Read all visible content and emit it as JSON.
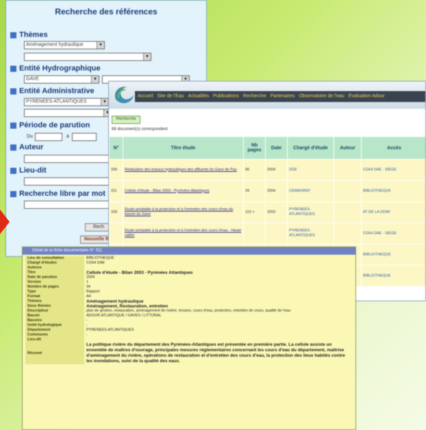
{
  "search_panel": {
    "title": "Recherche des références",
    "sections": {
      "themes": {
        "label": "Thèmes",
        "select1": "Aménagement hydraulique",
        "select2": ""
      },
      "entite_hydro": {
        "label": "Entité Hydrographique",
        "select1": "GAVE",
        "select2": ""
      },
      "entite_admin": {
        "label": "Entité Administrative",
        "select1": "PYRENEES-ATLANTIQUES",
        "select2": ""
      },
      "periode": {
        "label": "Période de parution",
        "from": "Du",
        "to": "à"
      },
      "auteur": {
        "label": "Auteur"
      },
      "lieu_dit": {
        "label": "Lieu-dit"
      },
      "recherche_libre": {
        "label": "Recherche libre par mot"
      }
    },
    "buttons": {
      "search": "Rech",
      "reset": "Nouvelle R"
    }
  },
  "results_window": {
    "nav": [
      "Accueil",
      "Site de l'Eau",
      "Actualités",
      "Publications",
      "Recherche",
      "Partenaires",
      "Observatoire de l'eau",
      "Evaluation Adour"
    ],
    "new_search_label": "Recherche",
    "result_count": "68 document(s) correspondent",
    "columns": [
      "N°",
      "Titre étude",
      "Nb pages",
      "Date",
      "Chargé d'étude",
      "Auteur",
      "Accès"
    ],
    "rows": [
      {
        "num": "336",
        "title": "Réalisation des travaux hydrauliques des affluents du Gave de Pau",
        "pages": "96",
        "date": "2004",
        "charge": "DDE",
        "auteur": "",
        "acces": "CG64 DAE · SIEGE"
      },
      {
        "num": "311",
        "title": "Cellule d'étude - Bilan 2003 - Pyrénées Atlantiques",
        "pages": "34",
        "date": "2004",
        "charge": "CEMAGREF",
        "auteur": "",
        "acces": "BIBLIOTHEQUE"
      },
      {
        "num": "328",
        "title": "Etude préalable à la protection et à l'entretien des cours d'eau du bassin du Gave",
        "pages": "115 +",
        "date": "2003",
        "charge": "PYRENEES-ATLANTIQUES",
        "auteur": "",
        "acces": "AT DE LA DDAF"
      },
      {
        "num": "",
        "title": "Etude préalable à la protection et à l'entretien des cours d'eau - Haute vallée",
        "pages": "",
        "date": "",
        "charge": "PYRENEES-ATLANTIQUES",
        "auteur": "",
        "acces": "CG64 DAE · SIEGE"
      },
      {
        "num": "",
        "title": "",
        "pages": "",
        "date": "",
        "charge": "",
        "auteur": "",
        "acces": "BIBLIOTHEQUE"
      },
      {
        "num": "",
        "title": "",
        "pages": "",
        "date": "",
        "charge": "",
        "auteur": "",
        "acces": "BIBLIOTHEQUE"
      }
    ]
  },
  "detail_window": {
    "title": "Détail de la fiche documentaire N° 311",
    "fields": [
      {
        "key": "Lieu de consultation",
        "value": "BIBLIOTHEQUE"
      },
      {
        "key": "Chargé d'études",
        "value": "CG64 DAE"
      },
      {
        "key": "Auteurs",
        "value": ""
      },
      {
        "key": "Titre",
        "value": "Cellule d'étude - Bilan 2003 - Pyrénées Atlantiques",
        "bold": true
      },
      {
        "key": "Date de parution",
        "value": "2004"
      },
      {
        "key": "Version",
        "value": "1"
      },
      {
        "key": "Nombre de pages",
        "value": "34"
      },
      {
        "key": "Type",
        "value": "Rapport"
      },
      {
        "key": "Format",
        "value": "A4"
      },
      {
        "key": "Thèmes",
        "value": "Aménagement hydraulique",
        "bold": true
      },
      {
        "key": "Sous thèmes",
        "value": "Aménagement, Restauration, entretien",
        "bold": true
      },
      {
        "key": "Descripteur",
        "value": "plan de gestion, restauration, aménagement de rivière, érosion, cours d'eau, protection, entretien de cours, qualité de l'eau"
      },
      {
        "key": "Bassin",
        "value": "ADOUR-ATLANTIQUE / GAVES / LITTORAL"
      },
      {
        "key": "Bassins",
        "value": "-"
      },
      {
        "key": "Unité hydrologique",
        "value": "-"
      },
      {
        "key": "Département",
        "value": "PYRENEES-ATLANTIQUES"
      },
      {
        "key": "Communes",
        "value": "-"
      },
      {
        "key": "Lieu-dit",
        "value": ""
      },
      {
        "key": "Résumé",
        "value": "La politique rivière du département des Pyrénées-Atlantiques est présentée en première partie. La cellule assiste un ensemble de maîtres d'ouvrage, principales mesures réglementaires concernant les cours d'eau du département, maîtrise d'aménagement du rivière, opérations de restauration et d'entretien des cours d'eau, la protection des lieux habités contre les inondations, suivi de la qualité des eaux.",
        "bold": true
      }
    ]
  }
}
